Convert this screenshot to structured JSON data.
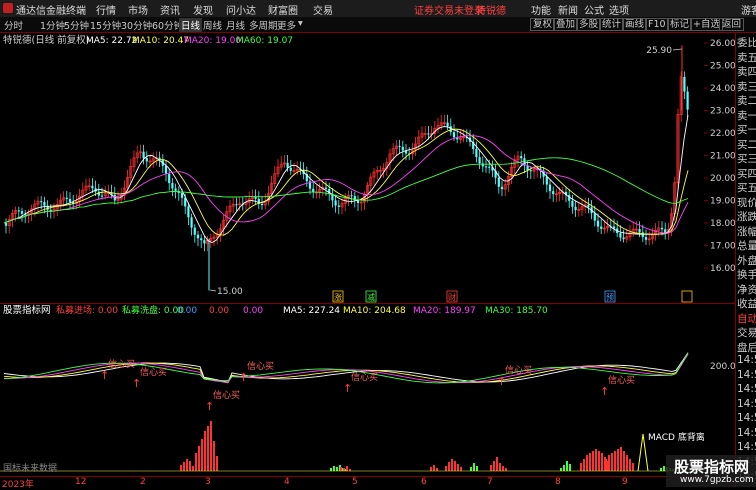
{
  "app": {
    "title": "通达信金融终端"
  },
  "menus": [
    "行情",
    "市场",
    "资讯",
    "发现",
    "问小达",
    "财富圈",
    "交易"
  ],
  "alert": {
    "left": "证券交易未登录",
    "right": "特锐德"
  },
  "window_menus": [
    "功能",
    "新闻",
    "公式",
    "选项",
    "游客"
  ],
  "periods": [
    "分时",
    "1分钟",
    "5分钟",
    "15分钟",
    "30分钟",
    "60分钟",
    "日线",
    "周线",
    "月线",
    "多周期",
    "更多"
  ],
  "active_period": "日线",
  "right_tools": [
    "复权",
    "叠加",
    "多股",
    "统计",
    "画线",
    "F10",
    "标记",
    "+自选",
    "返回"
  ],
  "kline": {
    "name": "特锐德(日线 前复权)",
    "ma": [
      {
        "label": "MA5: 22.72",
        "color": "#ffffff"
      },
      {
        "label": "MA10: 20.47",
        "color": "#ffff40"
      },
      {
        "label": "MA20: 19.00",
        "color": "#ff40ff"
      },
      {
        "label": "MA60: 19.07",
        "color": "#40ff40"
      }
    ],
    "high_label": "25.90",
    "low_label": "15.00",
    "price_ticks": [
      "26.00",
      "25.00",
      "24.00",
      "23.00",
      "22.00",
      "21.00",
      "20.00",
      "19.00",
      "18.00",
      "17.00",
      "16.00"
    ],
    "events": [
      "涨",
      "减",
      "财",
      "预"
    ]
  },
  "indicator": {
    "name": "股票指标网",
    "legend": [
      {
        "label": "私募进场: 0.00",
        "color": "#ff4040"
      },
      {
        "label": "私募洗盘: 0.00",
        "color": "#40ff40"
      },
      {
        "label": "0.00",
        "color": "#40a0ff"
      },
      {
        "label": "0.00",
        "color": "#ff4040"
      },
      {
        "label": "0.00",
        "color": "#ff40ff"
      },
      {
        "label": "MA5: 227.24",
        "color": "#ffffff"
      },
      {
        "label": "MA10: 204.68",
        "color": "#ffff40"
      },
      {
        "label": "MA20: 189.97",
        "color": "#ff40ff"
      },
      {
        "label": "MA30: 185.70",
        "color": "#40ff40"
      }
    ],
    "value_tick": "200.0",
    "signal_label": "信心买",
    "macd_label": "MACD 底背离",
    "footer_label": "国标未来数据"
  },
  "time_axis": [
    "2023年",
    "12",
    "2",
    "3",
    "4",
    "5",
    "6",
    "7",
    "8",
    "9"
  ],
  "right_panel": [
    {
      "label": "委比",
      "red": false
    },
    {
      "label": "卖五",
      "red": false
    },
    {
      "label": "卖四",
      "red": false
    },
    {
      "label": "卖三",
      "red": false
    },
    {
      "label": "卖二",
      "red": false
    },
    {
      "label": "卖一",
      "red": false
    },
    {
      "label": "买一",
      "red": false
    },
    {
      "label": "买二",
      "red": false
    },
    {
      "label": "买三",
      "red": false
    },
    {
      "label": "买四",
      "red": false
    },
    {
      "label": "买五",
      "red": false
    },
    {
      "label": "现价",
      "red": false
    },
    {
      "label": "涨跌",
      "red": false
    },
    {
      "label": "涨幅",
      "red": false
    },
    {
      "label": "总量",
      "red": false
    },
    {
      "label": "外盘",
      "red": false
    },
    {
      "label": "换手",
      "red": false
    },
    {
      "label": "净资",
      "red": false
    },
    {
      "label": "收益",
      "red": false
    },
    {
      "label": "自动",
      "red": true
    },
    {
      "label": "交易",
      "red": false
    },
    {
      "label": "盘后",
      "red": false
    },
    {
      "label": "14:50",
      "red": false
    },
    {
      "label": "14:50",
      "red": false
    },
    {
      "label": "14:50",
      "red": false
    },
    {
      "label": "14:50",
      "red": false
    },
    {
      "label": "14:50",
      "red": false
    },
    {
      "label": "14:50",
      "red": false
    },
    {
      "label": "14:50",
      "red": false
    },
    {
      "label": "14:50",
      "red": false
    },
    {
      "label": "14:50",
      "red": false
    }
  ],
  "watermark": {
    "title": "股票指标网",
    "url": "www.7gpzb.com"
  },
  "colors": {
    "up": "#ff3232",
    "down": "#54ffff",
    "border": "#800000",
    "ma5": "#ffffff",
    "ma10": "#ffff40",
    "ma20": "#ff40ff",
    "ma60": "#40ff40"
  }
}
